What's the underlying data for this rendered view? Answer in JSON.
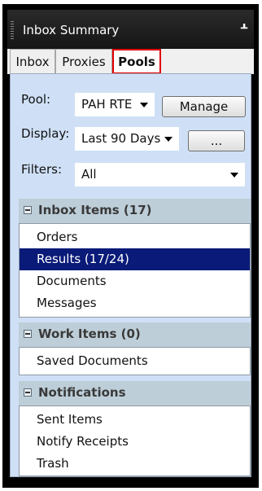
{
  "window": {
    "title": "Inbox Summary",
    "pin_glyph": "ᚆ"
  },
  "tabs": [
    {
      "label": "Inbox",
      "active": false
    },
    {
      "label": "Proxies",
      "active": false
    },
    {
      "label": "Pools",
      "active": true
    }
  ],
  "pool": {
    "label": "Pool:",
    "value": "PAH RTE",
    "manage_button": "Manage"
  },
  "display": {
    "label": "Display:",
    "value": "Last 90 Days",
    "more_button": "..."
  },
  "filters": {
    "label": "Filters:",
    "value": "All"
  },
  "sections": {
    "inbox": {
      "title": "Inbox Items (17)",
      "items": [
        "Orders",
        "Results (17/24)",
        "Documents",
        "Messages"
      ],
      "selected": "Results (17/24)"
    },
    "work": {
      "title": "Work Items (0)",
      "items": [
        "Saved Documents"
      ]
    },
    "notifications": {
      "title": "Notifications",
      "items": [
        "Sent Items",
        "Notify Receipts",
        "Trash"
      ]
    }
  },
  "colors": {
    "selection": "#0a1a78",
    "panel": "#cfe0f6",
    "section_header": "#bdced8",
    "active_tab_border": "#e00000"
  }
}
